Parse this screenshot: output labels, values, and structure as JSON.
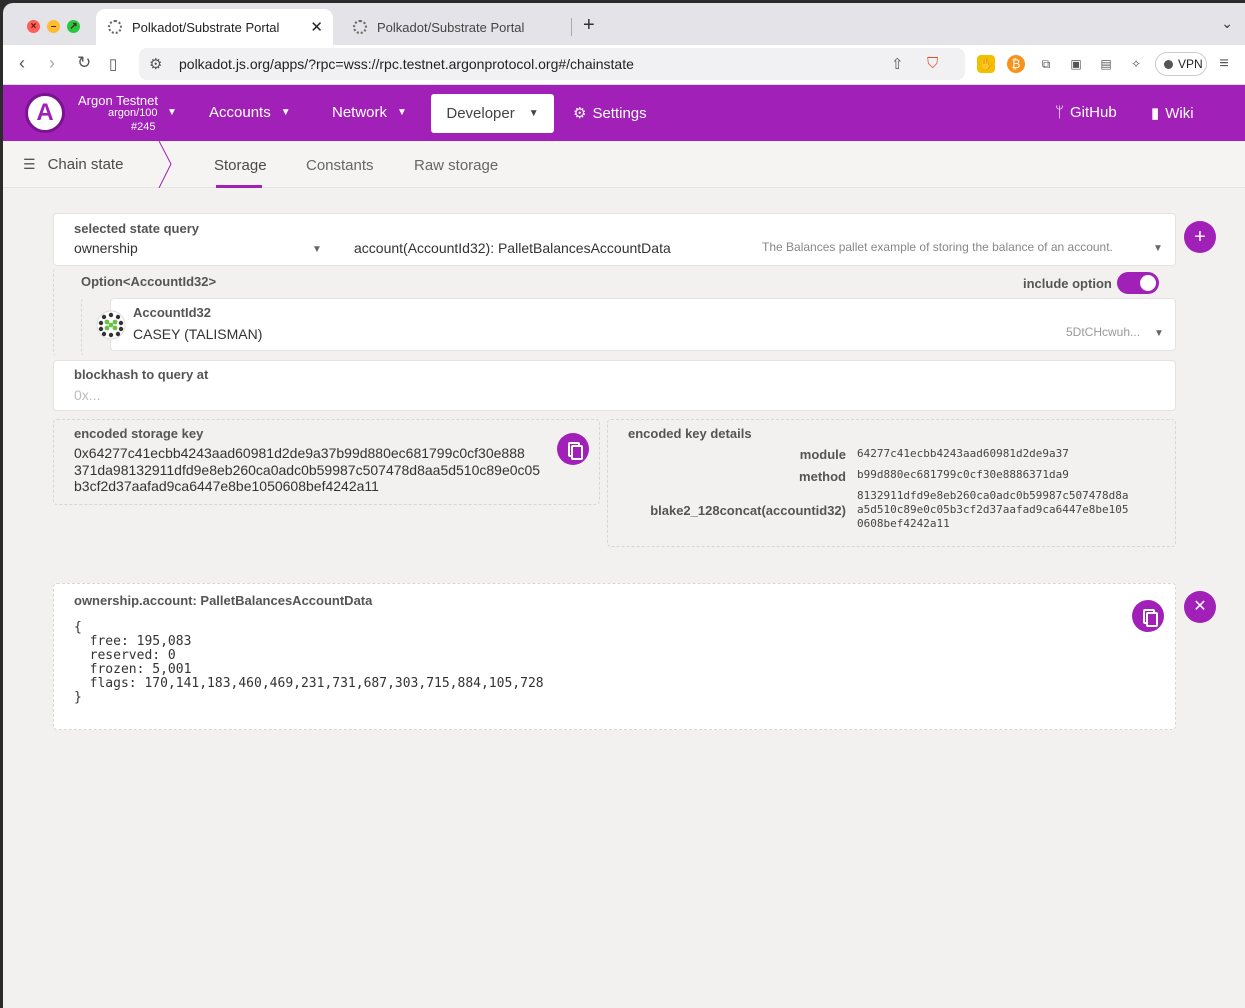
{
  "browser": {
    "tabs": [
      {
        "title": "Polkadot/Substrate Portal",
        "active": true
      },
      {
        "title": "Polkadot/Substrate Portal",
        "active": false
      }
    ],
    "close_glyph": "✕",
    "newtab_glyph": "+",
    "url": "polkadot.js.org/apps/?rpc=wss://rpc.testnet.argonprotocol.org#/chainstate",
    "vpn_label": "VPN"
  },
  "header": {
    "logo_letter": "A",
    "chain_name": "Argon Testnet",
    "chain_spec": "argon/100",
    "block": "#245",
    "menu": {
      "accounts": "Accounts",
      "network": "Network",
      "developer": "Developer",
      "settings": "Settings",
      "github": "GitHub",
      "wiki": "Wiki"
    }
  },
  "subnav": {
    "title": "Chain state",
    "tabs": [
      "Storage",
      "Constants",
      "Raw storage"
    ]
  },
  "query": {
    "label": "selected state query",
    "pallet": "ownership",
    "method": "account(AccountId32): PalletBalancesAccountData",
    "description": "The Balances pallet example of storing the balance of an account.",
    "option_label": "Option<AccountId32>",
    "include_option_label": "include option",
    "account_label": "AccountId32",
    "account_name": "CASEY (TALISMAN)",
    "account_address": "5DtCHcwuh...",
    "blockhash_label": "blockhash to query at",
    "blockhash_placeholder": "0x..."
  },
  "encoded": {
    "storage_key_label": "encoded storage key",
    "storage_key_lines": [
      "0x64277c41ecbb4243aad60981d2de9a37b99d880ec681799c0cf30e888",
      "371da98132911dfd9e8eb260ca0adc0b59987c507478d8aa5d510c89e0c05",
      "b3cf2d37aafad9ca6447e8be1050608bef4242a11"
    ],
    "details_label": "encoded key details",
    "module_label": "module",
    "module_value": "64277c41ecbb4243aad60981d2de9a37",
    "method_label": "method",
    "method_value": "b99d880ec681799c0cf30e8886371da9",
    "hasher_label": "blake2_128concat(accountid32)",
    "hasher_lines": [
      "8132911dfd9e8eb260ca0adc0b59987c507478d8a",
      "a5d510c89e0c05b3cf2d37aafad9ca6447e8be105",
      "0608bef4242a11"
    ]
  },
  "result": {
    "title": "ownership.account: PalletBalancesAccountData",
    "lines": [
      "{",
      "  free: 195,083",
      "  reserved: 0",
      "  frozen: 5,001",
      "  flags: 170,141,183,460,469,231,731,687,303,715,884,105,728",
      "}"
    ]
  },
  "colors": {
    "accent": "#a020b8",
    "background": "#f2f1f0"
  }
}
